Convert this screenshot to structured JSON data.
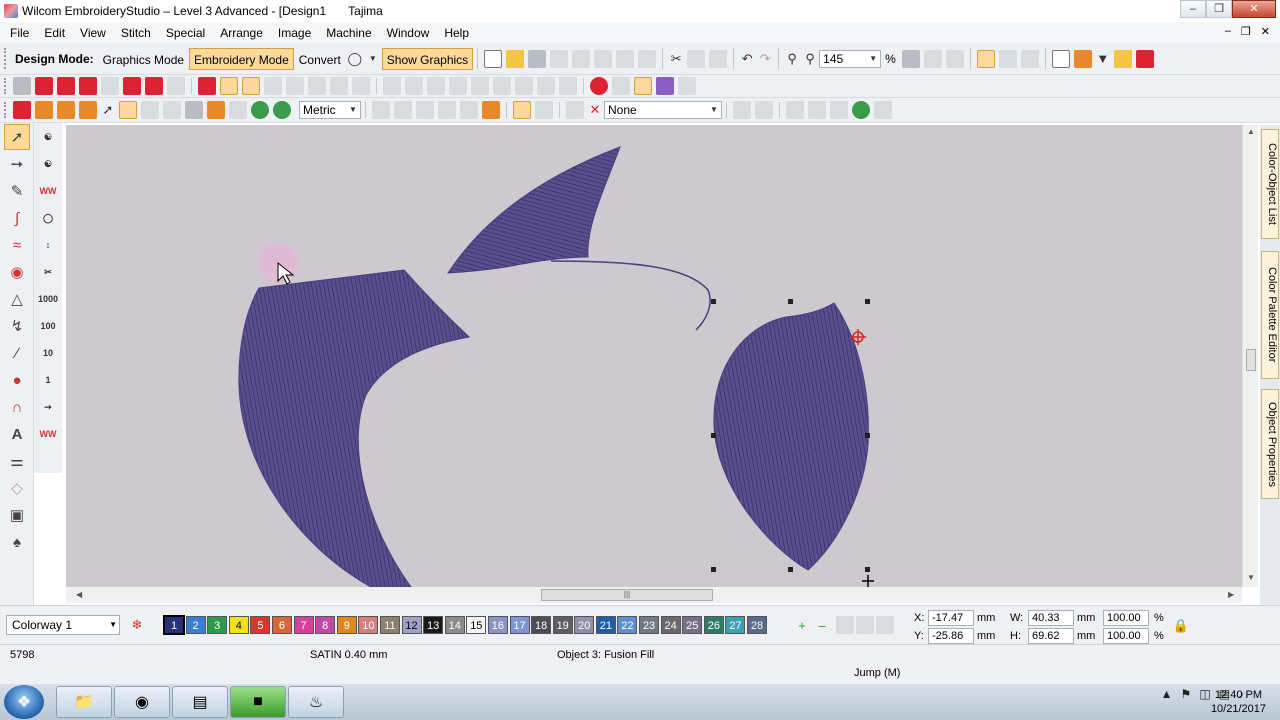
{
  "window": {
    "title": "Wilcom EmbroideryStudio – Level 3 Advanced - [Design1",
    "machine": "Tajima"
  },
  "menu": [
    "File",
    "Edit",
    "View",
    "Stitch",
    "Special",
    "Arrange",
    "Image",
    "Machine",
    "Window",
    "Help"
  ],
  "toolbar": {
    "design_mode_label": "Design Mode:",
    "graphics_mode": "Graphics Mode",
    "embroidery_mode": "Embroidery Mode",
    "convert": "Convert",
    "show_graphics": "Show Graphics",
    "zoom_value": "145",
    "zoom_unit": "%",
    "units_value": "Metric",
    "effect_value": "None"
  },
  "colorway": {
    "selected": "Colorway 1",
    "swatches": [
      {
        "n": "1",
        "color": "#2a2f7a"
      },
      {
        "n": "2",
        "color": "#3a7fd1"
      },
      {
        "n": "3",
        "color": "#2e9b4a"
      },
      {
        "n": "4",
        "color": "#f2e11a"
      },
      {
        "n": "5",
        "color": "#d63a2e"
      },
      {
        "n": "6",
        "color": "#d9663a"
      },
      {
        "n": "7",
        "color": "#d63f9b"
      },
      {
        "n": "8",
        "color": "#c04aa8"
      },
      {
        "n": "9",
        "color": "#e0881c"
      },
      {
        "n": "10",
        "color": "#d77e7e"
      },
      {
        "n": "11",
        "color": "#8d8070"
      },
      {
        "n": "12",
        "color": "#9fa2c8"
      },
      {
        "n": "13",
        "color": "#1a1a1a"
      },
      {
        "n": "14",
        "color": "#8a8a8a"
      },
      {
        "n": "15",
        "color": "#f5f5f5"
      },
      {
        "n": "16",
        "color": "#8a94c8"
      },
      {
        "n": "17",
        "color": "#7d94d6"
      },
      {
        "n": "18",
        "color": "#4d4d57"
      },
      {
        "n": "19",
        "color": "#5e5e5e"
      },
      {
        "n": "20",
        "color": "#8f8fa8"
      },
      {
        "n": "21",
        "color": "#1e5fa8"
      },
      {
        "n": "22",
        "color": "#5d8ed0"
      },
      {
        "n": "23",
        "color": "#6f7a86"
      },
      {
        "n": "24",
        "color": "#6a6a6a"
      },
      {
        "n": "25",
        "color": "#7a6e8a"
      },
      {
        "n": "26",
        "color": "#2f7b6a"
      },
      {
        "n": "27",
        "color": "#3ea0b0"
      },
      {
        "n": "28",
        "color": "#5a6a8a"
      }
    ]
  },
  "coords": {
    "x_label": "X:",
    "x_value": "-17.47",
    "x_unit": "mm",
    "y_label": "Y:",
    "y_value": "-25.86",
    "y_unit": "mm",
    "w_label": "W:",
    "w_value": "40.33",
    "w_unit": "mm",
    "w_pct": "100.00",
    "w_pct_unit": "%",
    "h_label": "H:",
    "h_value": "69.62",
    "h_unit": "mm",
    "h_pct": "100.00",
    "h_pct_unit": "%"
  },
  "status": {
    "stitch_count": "5798",
    "stitch_type": "SATIN  0.40 mm",
    "object_info": "Object 3: Fusion Fill",
    "jump": "Jump (M)"
  },
  "dock_tabs": [
    "Color-Object List",
    "Color Palette Editor",
    "Object Properties"
  ],
  "taskbar": {
    "time": "12:40 PM",
    "date": "10/21/2017"
  },
  "colors": {
    "stitch_fill": "#5b4e8e",
    "canvas_bg": "#cdc9cf",
    "accent_button": "#fcd99b"
  }
}
